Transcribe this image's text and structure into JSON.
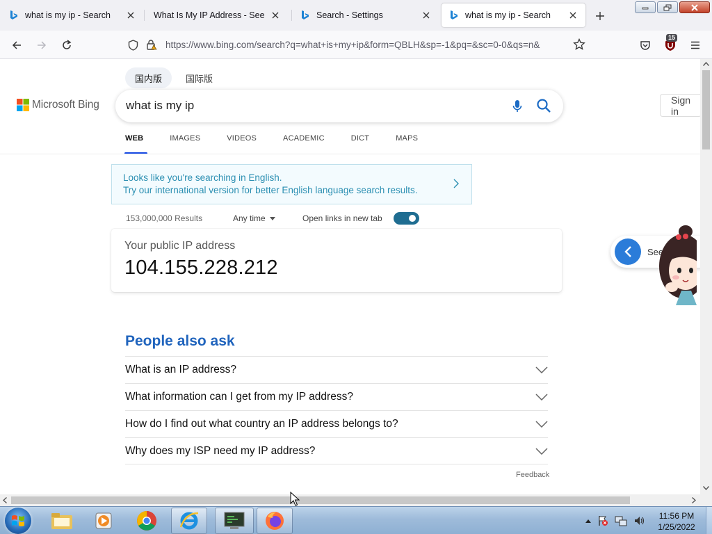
{
  "browser": {
    "tabs": [
      {
        "title": "what is my ip - Search",
        "favicon": "bing-icon",
        "active": false
      },
      {
        "title": "What Is My IP Address - See Your",
        "favicon": "none",
        "active": false
      },
      {
        "title": "Search - Settings",
        "favicon": "bing-icon",
        "active": false
      },
      {
        "title": "what is my ip - Search",
        "favicon": "bing-icon",
        "active": true
      }
    ],
    "url": "https://www.bing.com/search?q=what+is+my+ip&form=QBLH&sp=-1&pq=&sc=0-0&qs=n&",
    "extension_badge": "15"
  },
  "page": {
    "region_tabs": [
      "国内版",
      "国际版"
    ],
    "logo_text": "Microsoft Bing",
    "query": "what is my ip",
    "sign_in": "Sign in",
    "scopes": [
      "WEB",
      "IMAGES",
      "VIDEOS",
      "ACADEMIC",
      "DICT",
      "MAPS"
    ],
    "language_banner": {
      "line1": "Looks like you're searching in English.",
      "line2": "Try our international version for better English language search results."
    },
    "results_count": "153,000,000 Results",
    "time_filter": "Any time",
    "open_links_label": "Open links in new tab",
    "open_links_enabled": true,
    "ip_card": {
      "label": "Your public IP address",
      "value": "104.155.228.212"
    },
    "people_also_ask": {
      "title": "People also ask",
      "questions": [
        "What is an IP address?",
        "What information can I get from my IP address?",
        "How do I find out what country an IP address belongs to?",
        "Why does my ISP need my IP address?"
      ]
    },
    "feedback": "Feedback",
    "side_widget_text": "See"
  },
  "taskbar": {
    "time": "11:56 PM",
    "date": "1/25/2022"
  },
  "colors": {
    "bing_blue": "#174ae4",
    "paa_title": "#2064bd",
    "banner_text": "#2b8fb2",
    "toggle": "#1f6d91"
  }
}
